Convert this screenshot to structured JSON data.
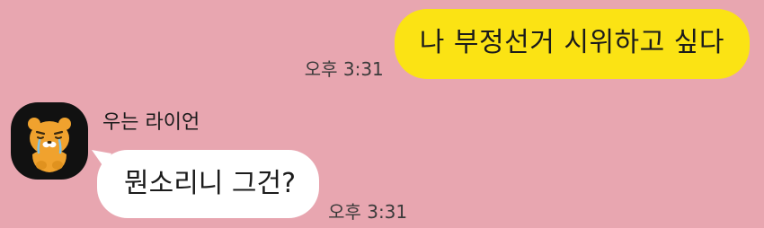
{
  "colors": {
    "background": "#e8a6b0",
    "outgoing_bubble": "#fbe314",
    "incoming_bubble": "#ffffff",
    "avatar_background": "#111111",
    "avatar_character": "#f0a22e"
  },
  "messages": {
    "outgoing": {
      "text": "나 부정선거 시위하고 싶다",
      "time": "오후 3:31"
    },
    "incoming": {
      "sender": "우는 라이언",
      "avatar_icon": "crying-ryan-icon",
      "text": "뭔소리니 그건?",
      "time": "오후 3:31"
    }
  }
}
